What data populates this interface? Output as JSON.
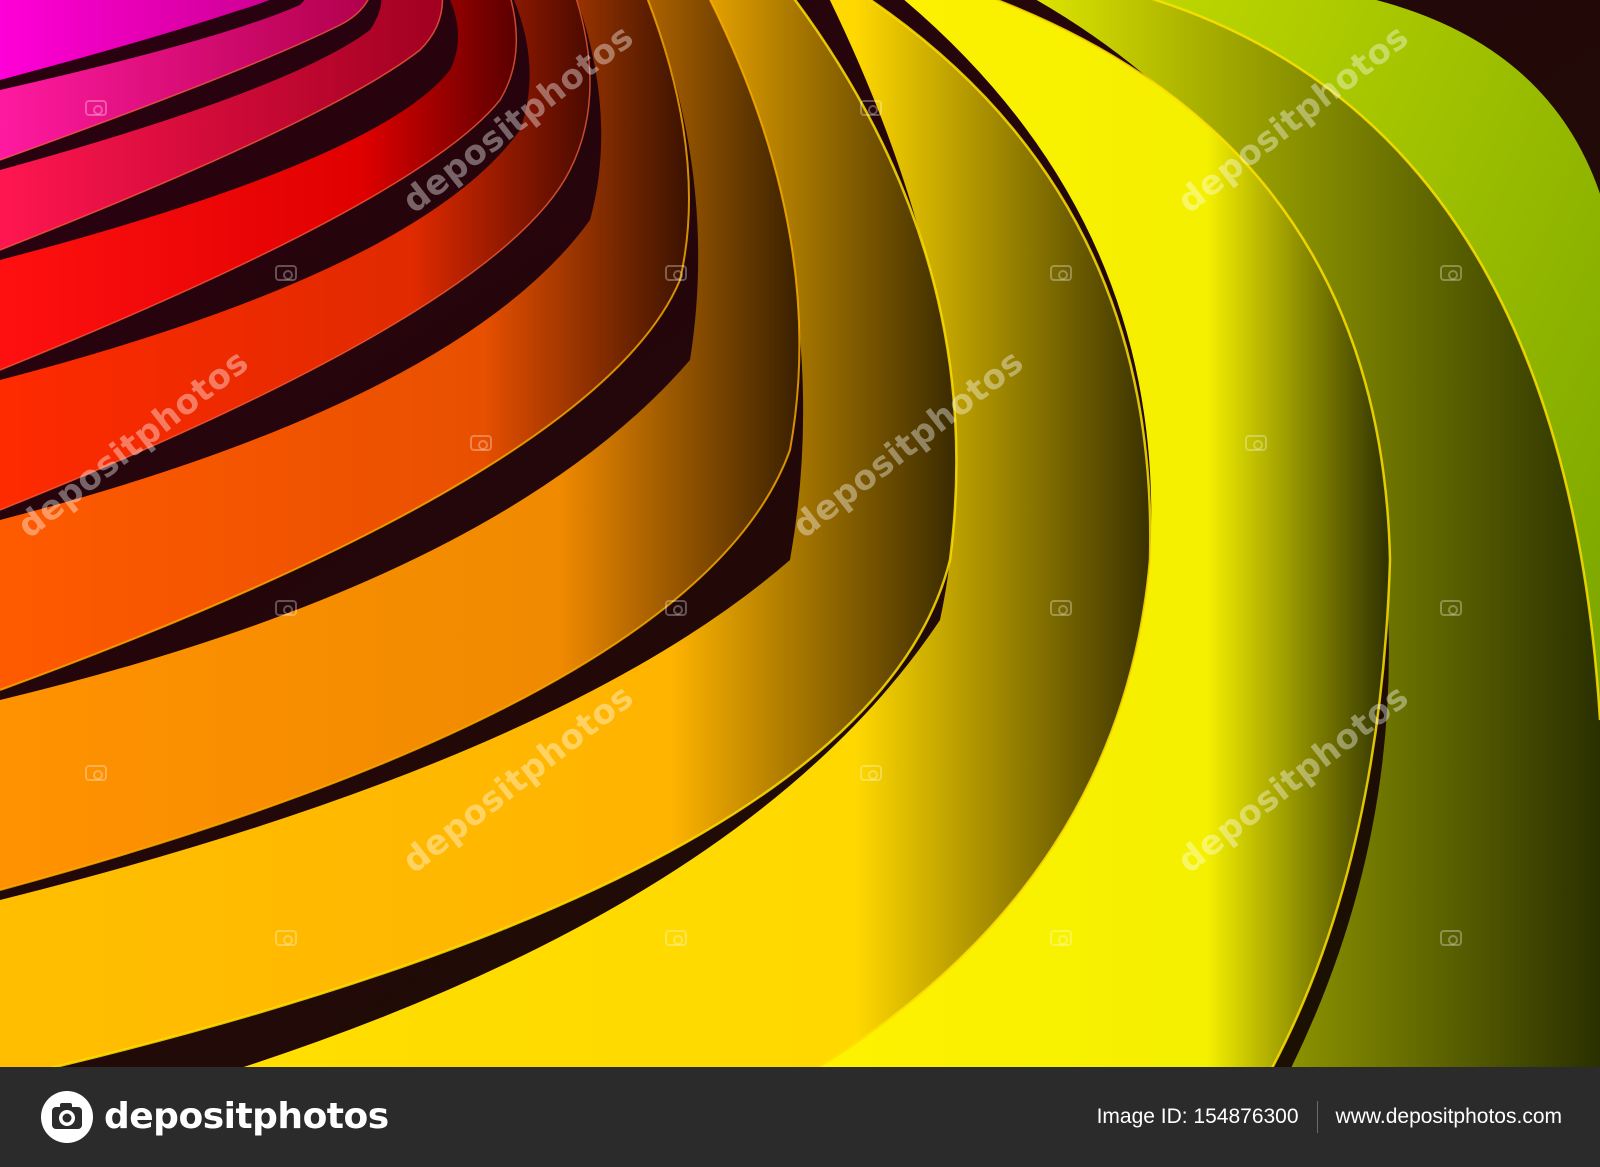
{
  "artwork": {
    "description_icon": "rainbow-paper-curls",
    "colors": [
      "#ff00cc",
      "#ff1a6a",
      "#ff1010",
      "#ff3a00",
      "#ff7a00",
      "#ffb000",
      "#ffd400",
      "#ffee00",
      "#d8e800",
      "#9acd00"
    ]
  },
  "watermark": {
    "text": "depositphotos"
  },
  "footer": {
    "logo_text": "depositphotos",
    "logo_icon": "camera-aperture-icon",
    "image_id": "Image ID: 154876300",
    "website": "www.depositphotos.com"
  }
}
